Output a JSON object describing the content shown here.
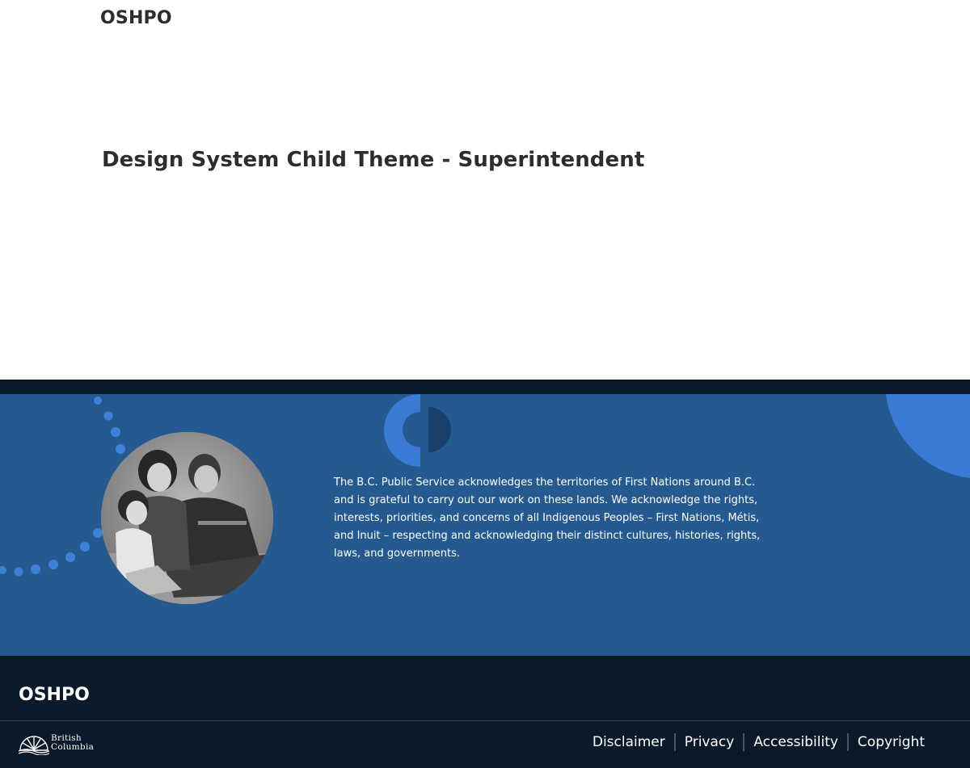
{
  "header": {
    "site_title": "OSHPO"
  },
  "main": {
    "page_title": "Design System Child Theme - Superintendent"
  },
  "land_acknowledgement": {
    "text": "The B.C. Public Service acknowledges the territories of First Nations around B.C. and is grateful to carry out our work on these lands. We acknowledge the rights, interests, priorities, and concerns of all Indigenous Peoples – First Nations, Métis, and Inuit – respecting and acknowledging their distinct cultures, histories, rights, laws, and governments.",
    "photo_icon": "family-photo"
  },
  "footer": {
    "site_title": "OSHPO",
    "logo_text": [
      "British",
      "Columbia"
    ],
    "links": [
      "Disclaimer",
      "Privacy",
      "Accessibility",
      "Copyright"
    ]
  },
  "colors": {
    "text": "#2d2d2d",
    "footer_bg": "#0b1a2b",
    "ack_bg": "#255a91",
    "accent_blue": "#3a7bd5"
  }
}
